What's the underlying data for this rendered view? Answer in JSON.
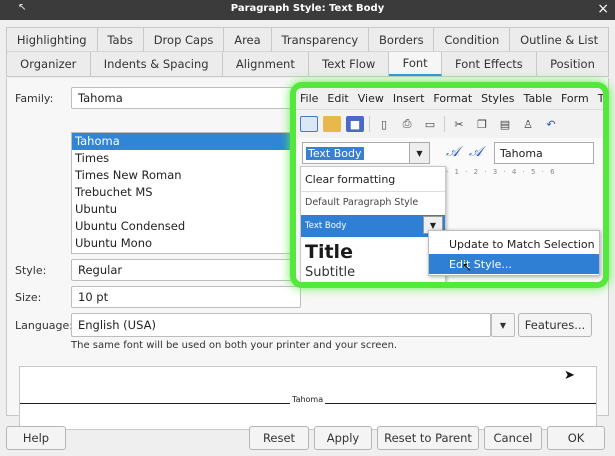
{
  "window": {
    "title": "Paragraph Style: Text Body",
    "close_glyph": "×"
  },
  "tabs_row1": [
    "Highlighting",
    "Tabs",
    "Drop Caps",
    "Area",
    "Transparency",
    "Borders",
    "Condition",
    "Outline & List"
  ],
  "tabs_row2": [
    "Organizer",
    "Indents & Spacing",
    "Alignment",
    "Text Flow",
    "Font",
    "Font Effects",
    "Position"
  ],
  "active_tab": "Font",
  "font": {
    "family_label": "Family:",
    "family_value": "Tahoma",
    "family_list": [
      "Tahoma",
      "Times",
      "Times New Roman",
      "Trebuchet MS",
      "Ubuntu",
      "Ubuntu Condensed",
      "Ubuntu Mono"
    ],
    "selected_family": "Tahoma",
    "style_label": "Style:",
    "style_value": "Regular",
    "size_label": "Size:",
    "size_value": "10 pt",
    "language_label": "Language:",
    "language_value": "English (USA)",
    "features_button": "Features...",
    "hint": "The same font will be used on both your printer and your screen.",
    "preview_text": "Tahoma"
  },
  "inset": {
    "menu": [
      "File",
      "Edit",
      "View",
      "Insert",
      "Format",
      "Styles",
      "Table",
      "Form",
      "T"
    ],
    "style_box_value": "Text Body",
    "font_box_value": "Tahoma",
    "style_list": {
      "clear": "Clear formatting",
      "default": "Default Paragraph Style",
      "text_body": "Text Body",
      "title": "Title",
      "subtitle": "Subtitle"
    },
    "context_menu": [
      "Update to Match Selection",
      "Edit Style..."
    ],
    "edge_fragment": "Aâ"
  },
  "footer": {
    "help": "Help",
    "reset": "Reset",
    "apply": "Apply",
    "reset_to_parent": "Reset to Parent",
    "cancel": "Cancel",
    "ok": "OK"
  },
  "colors": {
    "accent": "#2f85d6",
    "highlight_ring": "#55e83c"
  },
  "icons": [
    "close-icon",
    "dropdown-arrow-icon",
    "new-document-icon",
    "open-folder-icon",
    "save-icon",
    "print-icon",
    "cut-icon",
    "copy-icon",
    "paste-icon",
    "undo-icon",
    "styles-icon",
    "mouse-pointer-icon"
  ]
}
